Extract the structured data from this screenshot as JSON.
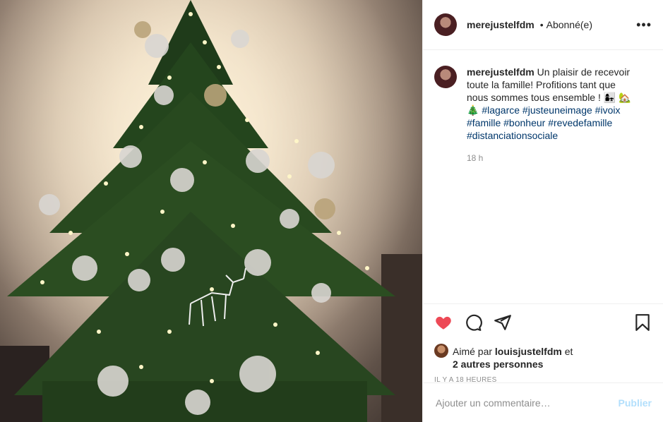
{
  "post": {
    "image_alt_icon": "christmas-tree-photo"
  },
  "header": {
    "username": "merejustelfdm",
    "separator": "•",
    "follow_status": "Abonné(e)",
    "more_icon": "more-horizontal-icon"
  },
  "caption": {
    "username": "merejustelfdm",
    "text": "Un plaisir de recevoir toute la famille! Profitions tant que nous sommes tous ensemble ! 👩‍👧 🏡 🎄",
    "hashtags": [
      "#lagarce",
      "#justeuneimage",
      "#ivoix",
      "#famille",
      "#bonheur",
      "#revedefamille",
      "#distanciationsociale"
    ],
    "time": "18 h"
  },
  "actions": {
    "like_icon": "heart-filled-icon",
    "comment_icon": "comment-icon",
    "share_icon": "share-icon",
    "save_icon": "bookmark-icon",
    "like_color": "#ed4956"
  },
  "likes": {
    "prefix": "Aimé par ",
    "user": "louisjustelfdm",
    "conjunction": " et",
    "others": "2 autres personnes"
  },
  "posted_ago": "IL Y A 18 HEURES",
  "comment": {
    "placeholder": "Ajouter un commentaire…",
    "publish_label": "Publier"
  }
}
